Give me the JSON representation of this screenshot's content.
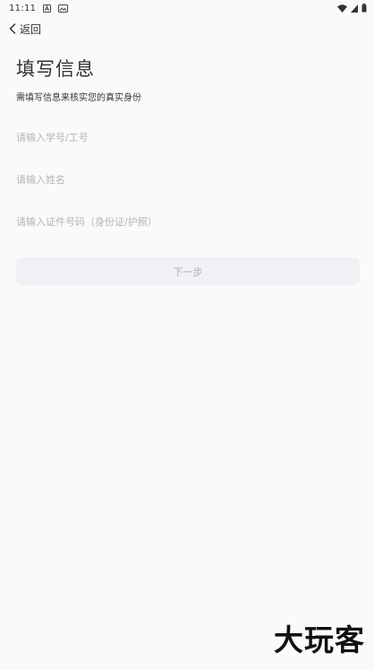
{
  "status_bar": {
    "time": "11:11",
    "left_icons": [
      "notification-a-icon",
      "gallery-icon"
    ],
    "right_icons": [
      "wifi-icon",
      "signal-icon",
      "battery-icon"
    ]
  },
  "nav": {
    "back_label": "返回"
  },
  "page": {
    "title": "填写信息",
    "subtitle": "需填写信息来核实您的真实身份"
  },
  "form": {
    "student_id_placeholder": "请输入学号/工号",
    "student_id_value": "",
    "name_placeholder": "请输入姓名",
    "name_value": "",
    "id_number_placeholder": "请输入证件号码（身份证/护照）",
    "id_number_value": "",
    "next_label": "下一步"
  },
  "watermark": {
    "text": "大玩客"
  },
  "colors": {
    "background": "#fafafa",
    "button_bg": "#f0f1f4",
    "button_text": "#b0b0b5",
    "placeholder": "#b4b4b8",
    "text": "#333333"
  }
}
